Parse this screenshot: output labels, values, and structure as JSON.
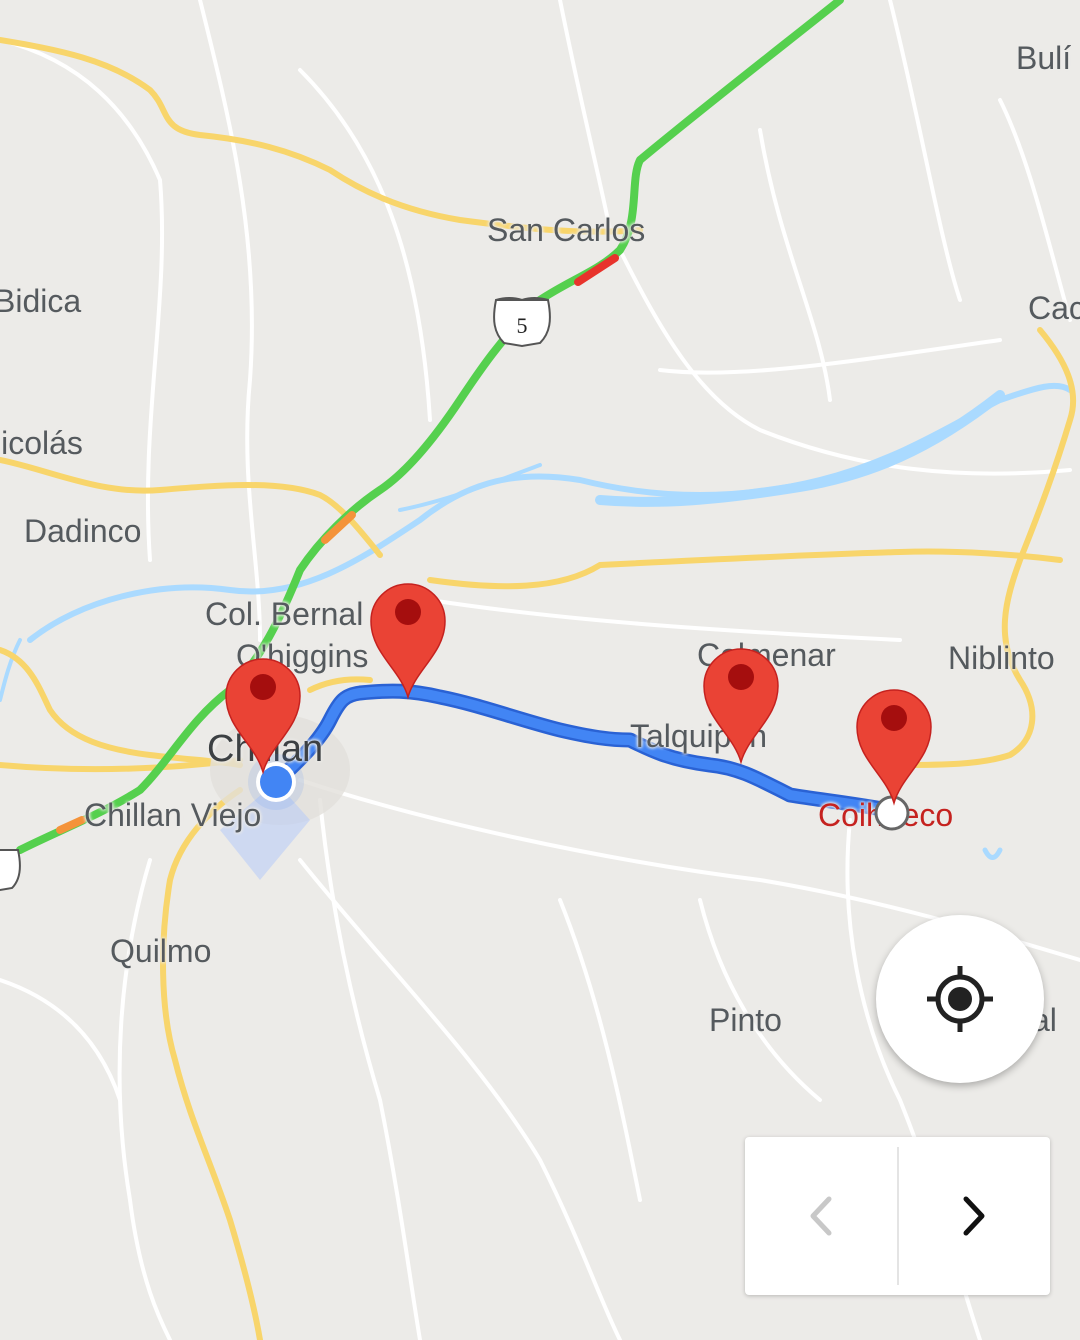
{
  "map": {
    "places": [
      {
        "id": "buli",
        "label": "Bulí",
        "type": "town"
      },
      {
        "id": "san-carlos",
        "label": "San Carlos",
        "type": "town"
      },
      {
        "id": "bidica",
        "label": "Bidica",
        "type": "town"
      },
      {
        "id": "cac",
        "label": "Cac",
        "type": "town"
      },
      {
        "id": "nicolas",
        "label": "licolás",
        "type": "town"
      },
      {
        "id": "dadinco",
        "label": "Dadinco",
        "type": "town"
      },
      {
        "id": "col-bernardo",
        "label": "Col. Bernal",
        "type": "town"
      },
      {
        "id": "ohiggins",
        "label": "O'higgins",
        "type": "town"
      },
      {
        "id": "chillan",
        "label": "Chillan",
        "type": "city"
      },
      {
        "id": "chillan-viejo",
        "label": "Chillan Viejo",
        "type": "town"
      },
      {
        "id": "colmenar",
        "label": "Colmenar",
        "type": "town"
      },
      {
        "id": "niblinto",
        "label": "Niblinto",
        "type": "town"
      },
      {
        "id": "talquipen",
        "label": "Talquipen",
        "type": "town"
      },
      {
        "id": "coihueco",
        "label": "Coihueco",
        "type": "destination"
      },
      {
        "id": "quilmo",
        "label": "Quilmo",
        "type": "town"
      },
      {
        "id": "pinto",
        "label": "Pinto",
        "type": "town"
      },
      {
        "id": "al",
        "label": "al",
        "type": "town"
      }
    ],
    "highway_shield": {
      "label": "5"
    },
    "markers": [
      {
        "id": "marker-1",
        "icon": "red-pin-icon"
      },
      {
        "id": "marker-2",
        "icon": "red-pin-icon"
      },
      {
        "id": "marker-3",
        "icon": "red-pin-icon"
      },
      {
        "id": "marker-4",
        "icon": "red-pin-icon"
      }
    ],
    "current_location": {
      "icon": "blue-location-dot-icon"
    },
    "route": {
      "color": "#4285f4"
    },
    "colors": {
      "land": "#ecebe8",
      "minor_road": "#ffffff",
      "major_road": "#f8d56b",
      "highway_traffic": "#55d04e",
      "traffic_slow": "#f4933a",
      "traffic_jam": "#e8332c",
      "water": "#aadaff",
      "marker": "#ea4335",
      "marker_dot": "#a50e0e"
    }
  },
  "controls": {
    "my_location": {
      "icon": "crosshair-location-icon"
    },
    "prev": {
      "icon": "chevron-left-icon",
      "disabled": true
    },
    "next": {
      "icon": "chevron-right-icon",
      "disabled": false
    }
  }
}
